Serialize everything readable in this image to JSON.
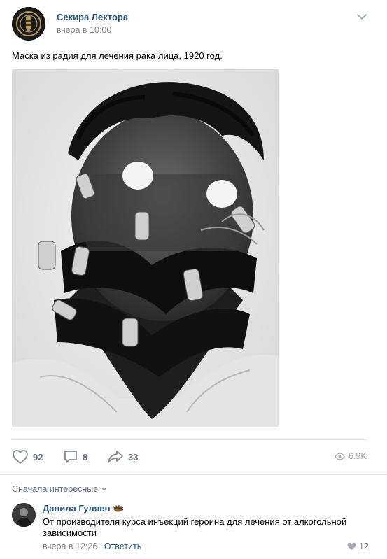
{
  "post": {
    "author": "Секира Лектора",
    "time": "вчера в 10:00",
    "text": "Маска из радия для лечения рака лица, 1920 год.",
    "image_icon": "photo-radium-mask"
  },
  "actions": {
    "likes": "92",
    "comments": "8",
    "shares": "33",
    "views": "6.9K"
  },
  "comments": {
    "sort_label": "Сначала интересные",
    "items": [
      {
        "author": "Данила Гуляев",
        "badge_icon": "hedgehog-icon",
        "text": "От производителя курса инъекций героина для лечения от алкогольной зависимости",
        "time": "вчера в 12:26",
        "reply_label": "Ответить",
        "likes": "12"
      }
    ]
  },
  "colors": {
    "link": "#2a5885",
    "action": "#5e6e84",
    "muted": "#828282",
    "divider": "#e7e8ec"
  }
}
